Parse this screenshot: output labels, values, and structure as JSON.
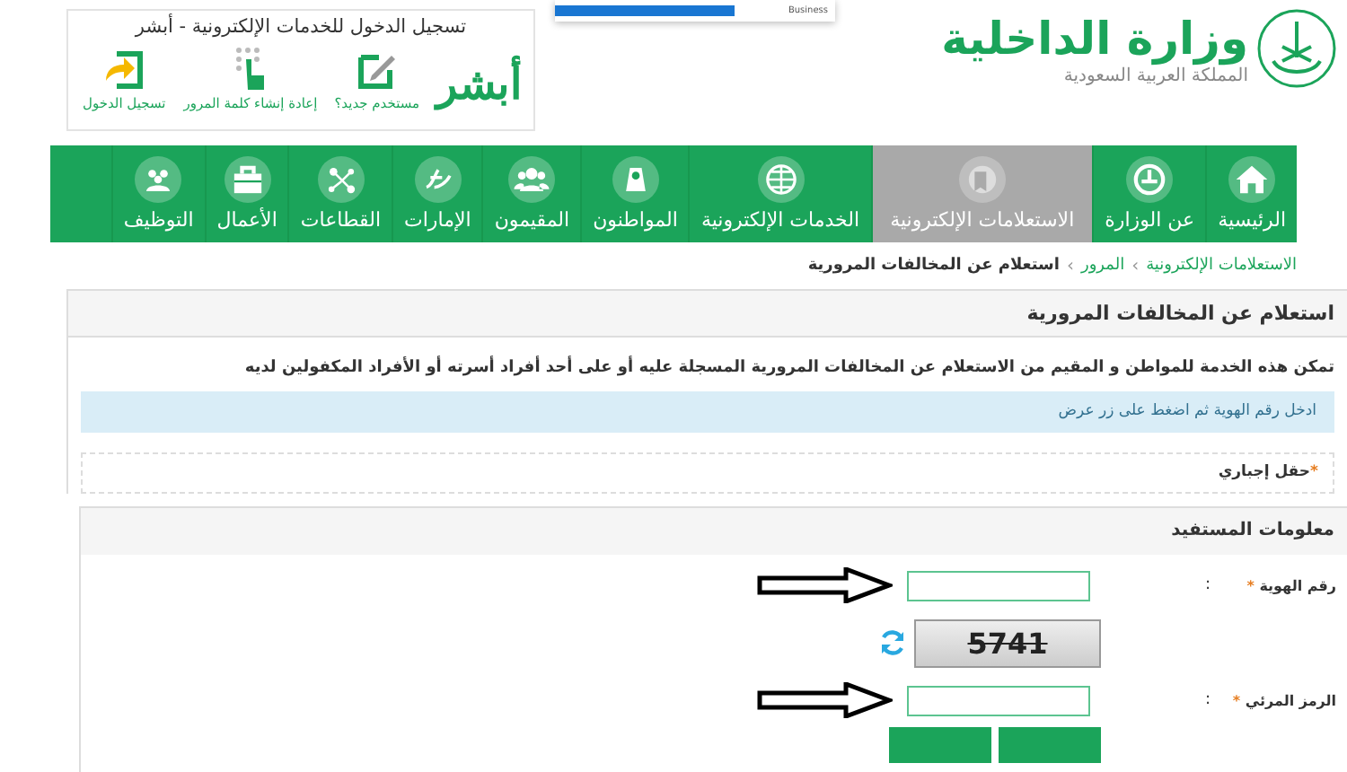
{
  "header": {
    "ministry": {
      "name": "وزارة الداخلية",
      "country": "المملكة العربية السعودية"
    },
    "popup": {
      "text": "Business"
    },
    "abshir": {
      "title": "تسجيل الدخول للخدمات الإلكترونية - أبشر",
      "logo": "أبشر",
      "links": [
        {
          "label": "مستخدم جديد؟",
          "kind": "pencil"
        },
        {
          "label": "إعادة إنشاء كلمة المرور",
          "kind": "keypad"
        },
        {
          "label": "تسجيل الدخول",
          "kind": "login"
        }
      ]
    }
  },
  "nav": {
    "items": [
      {
        "label": "الرئيسية",
        "kind": "home",
        "selected": false
      },
      {
        "label": "عن الوزارة",
        "kind": "emblem",
        "selected": false
      },
      {
        "label": "الاستعلامات الإلكترونية",
        "kind": "inquiry",
        "selected": true
      },
      {
        "label": "الخدمات الإلكترونية",
        "kind": "globe",
        "selected": false
      },
      {
        "label": "المواطنون",
        "kind": "citizen",
        "selected": false
      },
      {
        "label": "المقيمون",
        "kind": "people",
        "selected": false
      },
      {
        "label": "الإمارات",
        "kind": "script",
        "selected": false
      },
      {
        "label": "القطاعات",
        "kind": "network",
        "selected": false
      },
      {
        "label": "الأعمال",
        "kind": "briefcase",
        "selected": false
      },
      {
        "label": "التوظيف",
        "kind": "team",
        "selected": false
      }
    ]
  },
  "breadcrumb": {
    "separator": "›",
    "items": [
      {
        "label": "الاستعلامات الإلكترونية",
        "kind": "link"
      },
      {
        "label": "المرور",
        "kind": "link"
      },
      {
        "label": "استعلام عن المخالفات المرورية",
        "kind": "current"
      }
    ]
  },
  "panel": {
    "title": "استعلام عن المخالفات المرورية",
    "description": "تمكن هذه الخدمة للمواطن و المقيم من الاستعلام عن المخالفات المرورية المسجلة عليه أو على أحد أفراد أسرته أو الأفراد المكفولين لديه",
    "notice": "ادخل رقم الهوية ثم اضغط على زر عرض",
    "required_mark": "*",
    "required_note": "حقل إجباري"
  },
  "form": {
    "title": "معلومات المستفيد",
    "required_mark": "*",
    "fields": [
      {
        "kind": "text",
        "label": "رقم الهوية",
        "required": true,
        "colon": ":",
        "arrow": true
      },
      {
        "kind": "captcha",
        "code": "5741"
      },
      {
        "kind": "text",
        "label": "الرمز المرئي",
        "required": true,
        "colon": ":",
        "arrow": true
      }
    ]
  }
}
